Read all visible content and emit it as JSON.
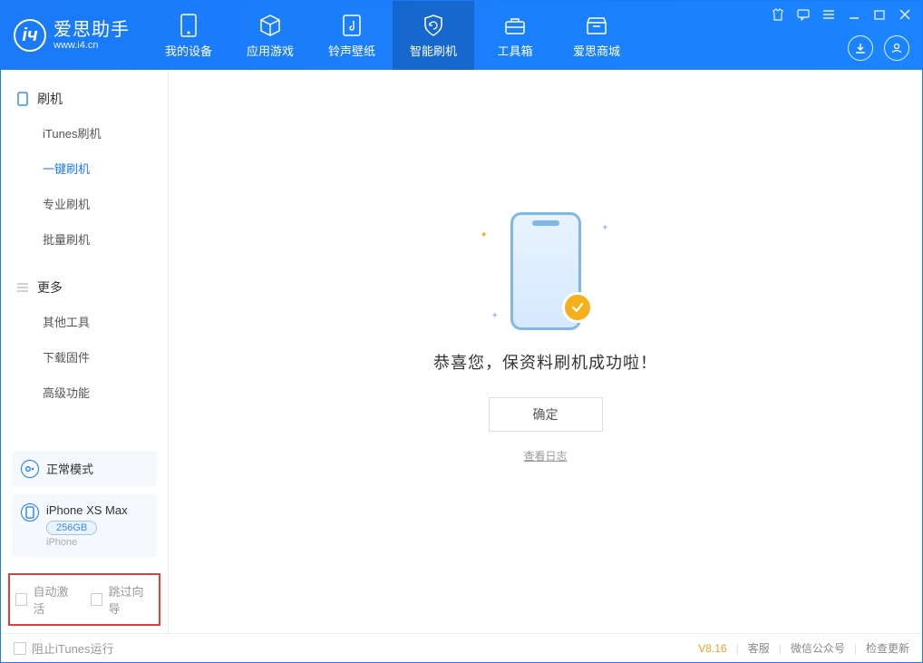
{
  "app": {
    "title": "爱思助手",
    "subtitle": "www.i4.cn"
  },
  "topTabs": {
    "device": "我的设备",
    "apps": "应用游戏",
    "ring": "铃声壁纸",
    "flash": "智能刷机",
    "toolbox": "工具箱",
    "store": "爱思商城"
  },
  "sidebar": {
    "group1": {
      "title": "刷机",
      "items": {
        "itunes": "iTunes刷机",
        "oneKey": "一键刷机",
        "pro": "专业刷机",
        "batch": "批量刷机"
      }
    },
    "group2": {
      "title": "更多",
      "items": {
        "other": "其他工具",
        "firmware": "下载固件",
        "advanced": "高级功能"
      }
    }
  },
  "device": {
    "mode": "正常模式",
    "name": "iPhone XS Max",
    "storage": "256GB",
    "type": "iPhone"
  },
  "checkboxes": {
    "autoActivate": "自动激活",
    "skipGuide": "跳过向导"
  },
  "main": {
    "successText": "恭喜您，保资料刷机成功啦！",
    "okButton": "确定",
    "viewLog": "查看日志"
  },
  "footer": {
    "blockItunes": "阻止iTunes运行",
    "version": "V8.16",
    "support": "客服",
    "wechat": "微信公众号",
    "update": "检查更新"
  }
}
